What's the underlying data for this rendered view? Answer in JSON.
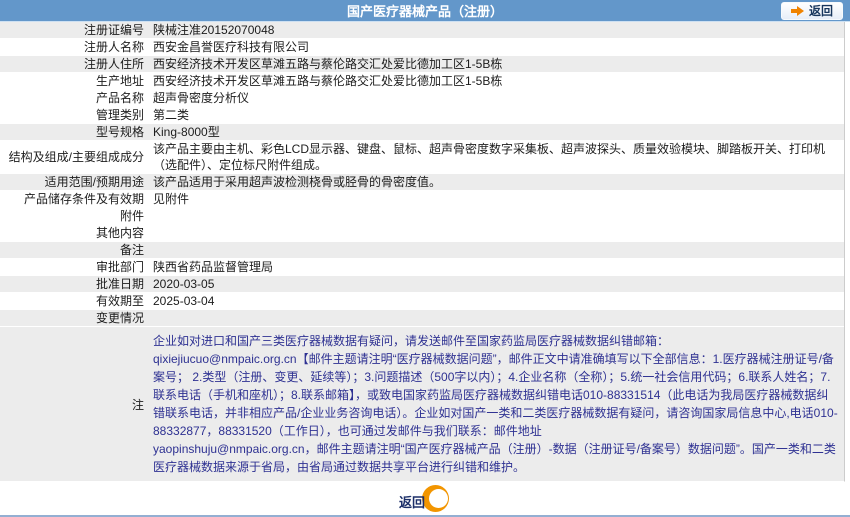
{
  "header": {
    "title": "国产医疗器械产品（注册）",
    "back_label": "返回"
  },
  "table": {
    "rows": [
      {
        "label": "注册证编号",
        "value": "陕械注准20152070048",
        "shaded": true
      },
      {
        "label": "注册人名称",
        "value": "西安金昌誉医疗科技有限公司",
        "shaded": false
      },
      {
        "label": "注册人住所",
        "value": "西安经济技术开发区草滩五路与蔡伦路交汇处爱比德加工区1-5B栋",
        "shaded": true
      },
      {
        "label": "生产地址",
        "value": "西安经济技术开发区草滩五路与蔡伦路交汇处爱比德加工区1-5B栋",
        "shaded": false
      },
      {
        "label": "产品名称",
        "value": "超声骨密度分析仪",
        "shaded": false
      },
      {
        "label": "管理类别",
        "value": "第二类",
        "shaded": false
      },
      {
        "label": "型号规格",
        "value": "King-8000型",
        "shaded": true
      },
      {
        "label": "结构及组成/主要组成成分",
        "value": "该产品主要由主机、彩色LCD显示器、键盘、鼠标、超声骨密度数字采集板、超声波探头、质量效验模块、脚踏板开关、打印机（选配件）、定位标尺附件组成。",
        "shaded": false
      },
      {
        "label": "适用范围/预期用途",
        "value": "该产品适用于采用超声波检测桡骨或胫骨的骨密度值。",
        "shaded": true
      },
      {
        "label": "产品储存条件及有效期",
        "value": "见附件",
        "shaded": false
      },
      {
        "label": "附件",
        "value": "",
        "shaded": false
      },
      {
        "label": "其他内容",
        "value": "",
        "shaded": false
      },
      {
        "label": "备注",
        "value": "",
        "shaded": true
      },
      {
        "label": "审批部门",
        "value": "陕西省药品监督管理局",
        "shaded": false
      },
      {
        "label": "批准日期",
        "value": "2020-03-05",
        "shaded": true
      },
      {
        "label": "有效期至",
        "value": "2025-03-04",
        "shaded": false
      },
      {
        "label": "变更情况",
        "value": "",
        "shaded": true
      }
    ]
  },
  "note": {
    "label": "注",
    "lines": [
      "企业如对进口和国产三类医疗器械数据有疑问，请发送邮件至国家药监局医疗器械数据纠错邮箱：",
      "qixiejiucuo@nmpaic.org.cn【邮件主题请注明“医疗器械数据问题”，邮件正文中请准确填写以下全部信息：1.医疗器械注册证号/备案号； 2.类型（注册、变更、延续等）；3.问题描述（500字以内）；4.企业名称（全称）；5.统一社会信用代码；6.联系人姓名；7.联系电话（手机和座机）；8.联系邮箱】，或致电国家药监局医疗器械数据纠错电话010-88331514（此电话为我局医疗器械数据纠错联系电话，并非相应产品/企业业务咨询电话）。企业如对国产一类和二类医疗器械数据有疑问，请咨询国家局信息中心,电话010-88332877，88331520（工作日），也可通过发邮件与我们联系：邮件地址",
      "yaopinshuju@nmpaic.org.cn，邮件主题请注明“国产医疗器械产品（注册）-数据（注册证号/备案号）数据问题”。国产一类和二类医疗器械数据来源于省局，由省局通过数据共享平台进行纠错和维护。"
    ]
  },
  "footer": {
    "back_label": "返回"
  },
  "colors": {
    "header_bg": "#6397ca",
    "row_shade": "#ececec",
    "note_text": "#2e3192",
    "navy_text": "#1c2f69",
    "accent_orange": "#f29500",
    "bottom_line": "#94afd2"
  }
}
